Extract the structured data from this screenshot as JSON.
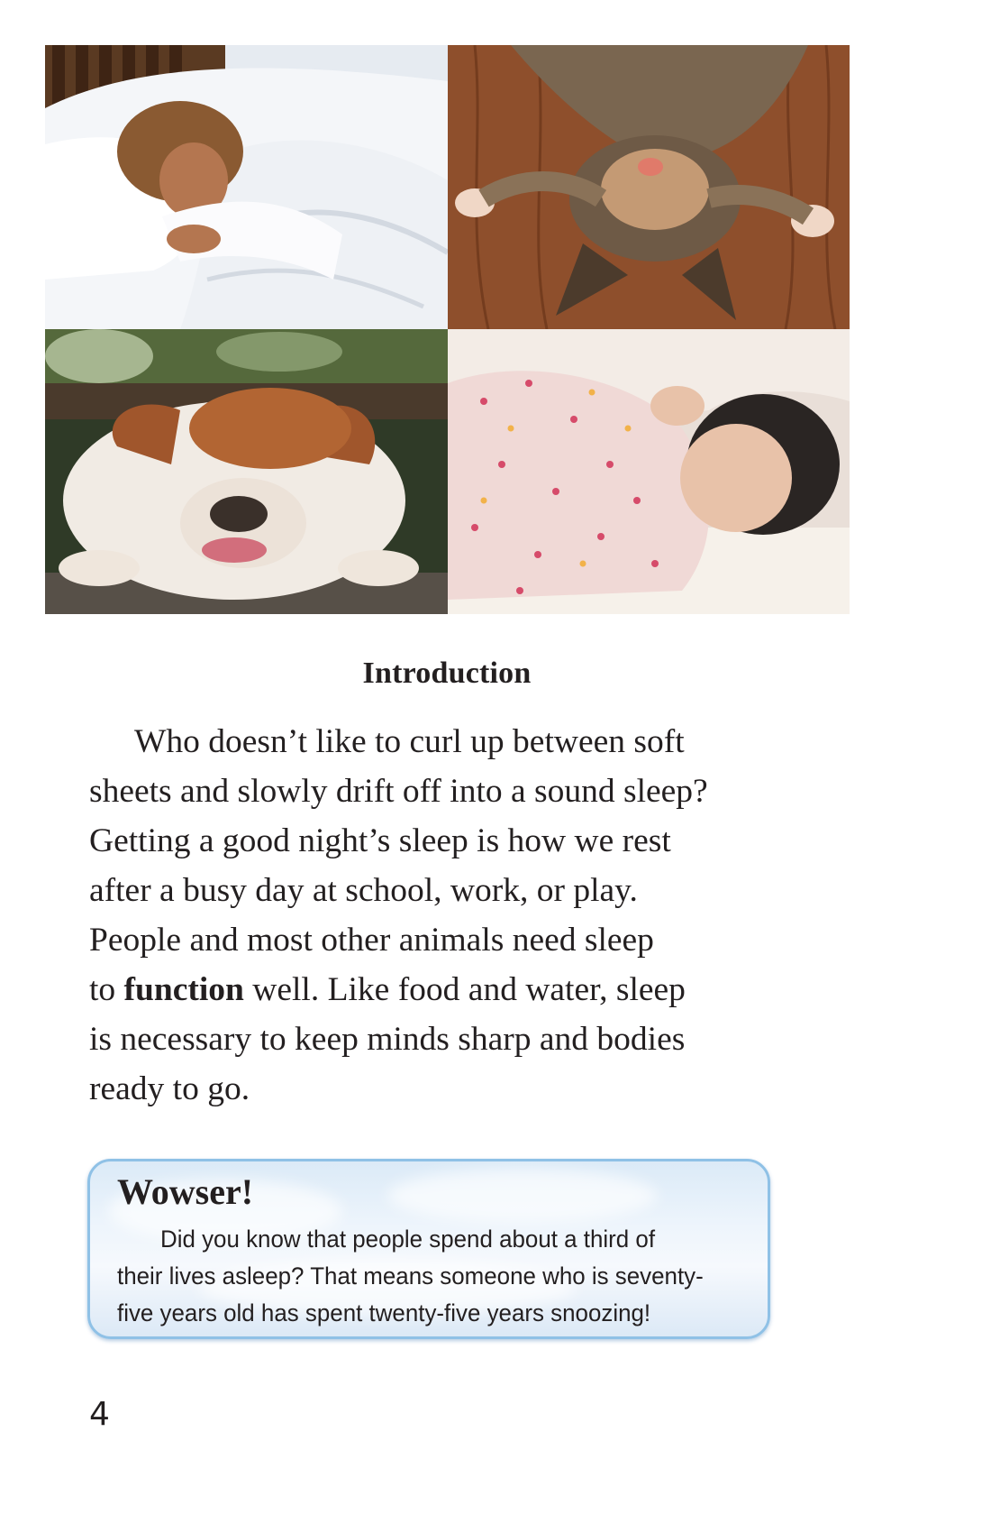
{
  "photos": [
    {
      "name": "woman-sleeping-photo"
    },
    {
      "name": "cat-sleeping-photo"
    },
    {
      "name": "bulldog-sleeping-photo"
    },
    {
      "name": "baby-sleeping-photo"
    }
  ],
  "section": {
    "heading": "Introduction",
    "lines": {
      "l1": "Who doesn’t like to curl up between soft",
      "l2": "sheets and slowly drift off into a sound sleep?",
      "l3": "Getting a good night’s sleep is how we rest",
      "l4": "after a busy day at school, work, or play.",
      "l5": "People and most other animals need sleep",
      "l6_pre": "to ",
      "l6_bold": "function",
      "l6_post": " well. Like food and water, sleep",
      "l7": "is necessary to keep minds sharp and bodies",
      "l8": "ready to go."
    }
  },
  "fact_box": {
    "title": "Wowser!",
    "lines": {
      "l1": "Did you know that people spend about a third of",
      "l2": "their lives asleep? That means someone who is seventy-",
      "l3": "five years old has spent twenty-five years snoozing!"
    }
  },
  "page_number": "4"
}
